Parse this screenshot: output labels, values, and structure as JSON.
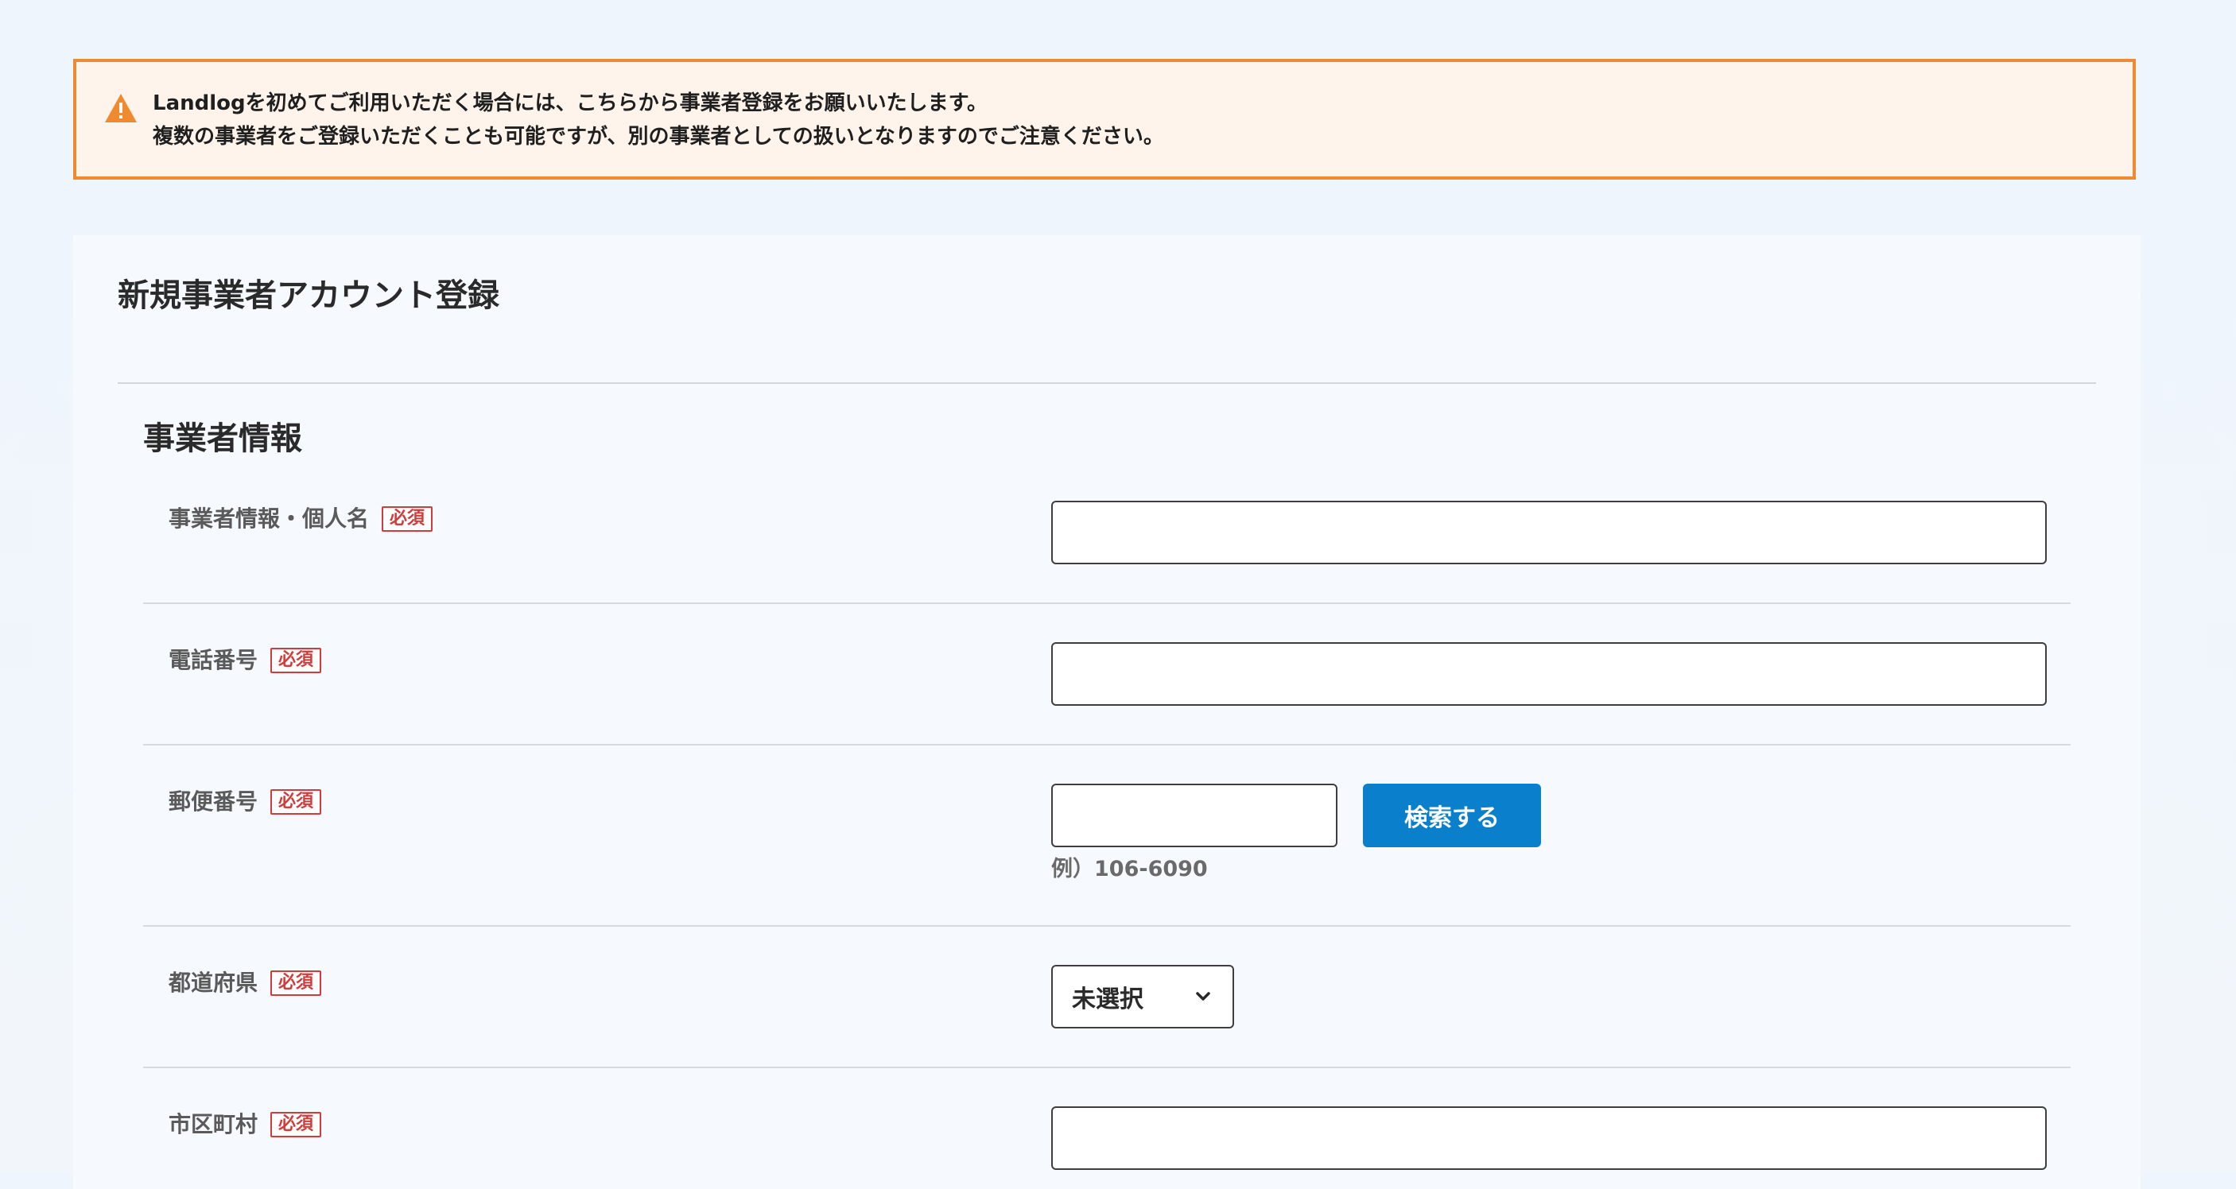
{
  "notice": {
    "line1": "Landlogを初めてご利用いただく場合には、こちらから事業者登録をお願いいたします。",
    "line2": "複数の事業者をご登録いただくことも可能ですが、別の事業者としての扱いとなりますのでご注意ください。",
    "icon": "warning-icon",
    "border_color": "#ef8a2f"
  },
  "form": {
    "title": "新規事業者アカウント登録",
    "section_title": "事業者情報",
    "required_label": "必須",
    "fields": {
      "business_name": {
        "label": "事業者情報・個人名",
        "value": ""
      },
      "phone": {
        "label": "電話番号",
        "value": ""
      },
      "postal_code": {
        "label": "郵便番号",
        "value": "",
        "search_label": "検索する",
        "example": "例）106-6090"
      },
      "prefecture": {
        "label": "都道府県",
        "selected": "未選択"
      },
      "city": {
        "label": "市区町村",
        "value": ""
      }
    }
  },
  "colors": {
    "primary_button": "#0a7fcb",
    "required_badge": "#d23b3b"
  }
}
